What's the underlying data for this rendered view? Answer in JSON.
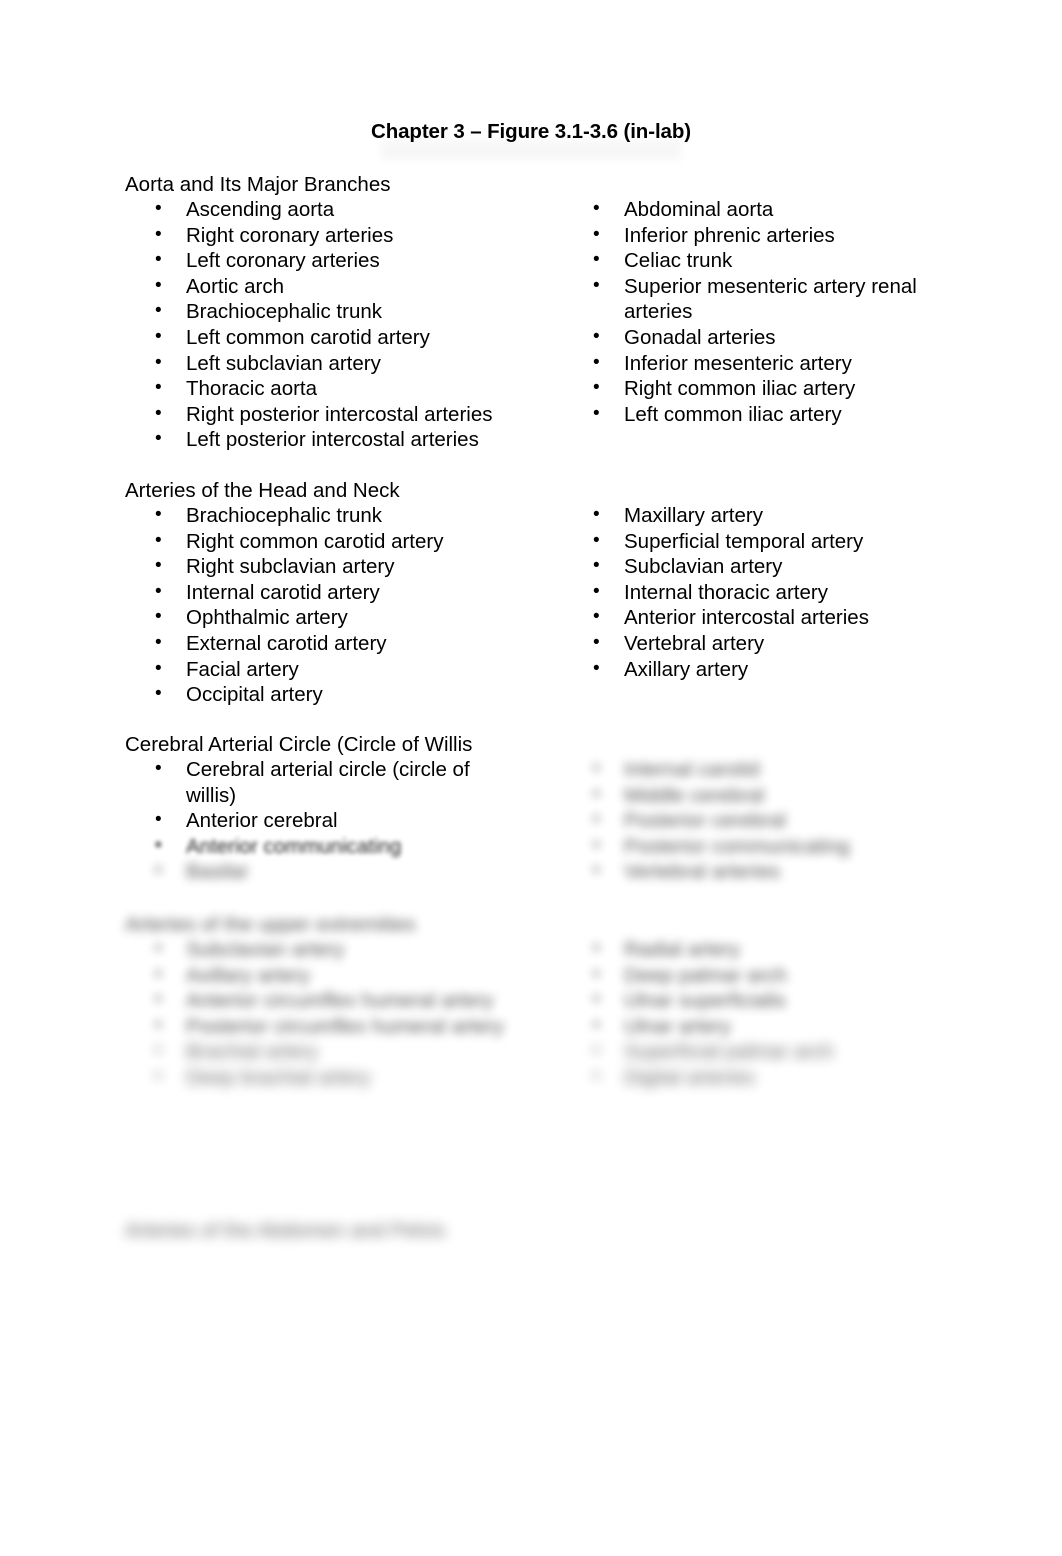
{
  "document": {
    "title": "Chapter 3 – Figure 3.1-3.6 (in-lab)"
  },
  "sections": [
    {
      "heading": "Aorta and Its Major Branches",
      "left_items": [
        "Ascending aorta",
        "Right coronary arteries",
        "Left coronary arteries",
        "Aortic arch",
        "Brachiocephalic trunk",
        "Left common carotid artery",
        "Left subclavian artery",
        "Thoracic aorta",
        "Right posterior intercostal arteries",
        "Left posterior intercostal arteries"
      ],
      "right_items": [
        "Abdominal aorta",
        "Inferior phrenic arteries",
        "Celiac trunk",
        "Superior mesenteric artery renal arteries",
        "Gonadal arteries",
        "Inferior mesenteric artery",
        "Right common iliac artery",
        "Left common iliac artery"
      ]
    },
    {
      "heading": "Arteries of the Head and Neck",
      "left_items": [
        "Brachiocephalic trunk",
        "Right common carotid artery",
        "Right subclavian artery",
        "Internal carotid artery",
        "Ophthalmic artery",
        "External carotid artery",
        "Facial artery",
        "Occipital artery"
      ],
      "right_items": [
        "Maxillary artery",
        "Superficial temporal artery",
        "Subclavian artery",
        "Internal thoracic artery",
        "Anterior intercostal arteries",
        "Vertebral artery",
        "Axillary artery"
      ]
    },
    {
      "heading": "Cerebral Arterial Circle (Circle of Willis",
      "left_items": [
        "Cerebral arterial circle (circle of willis)",
        "Anterior cerebral",
        "Anterior communicating",
        "Basilar"
      ],
      "right_items": [
        "Internal carotid",
        "Middle cerebral",
        "Posterior cerebral",
        "Posterior communicating",
        "Vertebral arteries"
      ]
    },
    {
      "heading": "Arteries of the upper extremities",
      "left_items": [
        "Subclavian artery",
        "Axillary artery",
        "Anterior circumflex humeral artery",
        "Posterior circumflex humeral artery",
        "Brachial artery",
        "Deep brachial artery"
      ],
      "right_items": [
        "Radial artery",
        "Deep palmar arch",
        "Ulnar superficialis",
        "Ulnar artery",
        "Superficial palmar arch",
        "Digital arteries"
      ]
    },
    {
      "heading": "Arteries of the Abdomen and Pelvis",
      "left_items": [],
      "right_items": []
    }
  ]
}
